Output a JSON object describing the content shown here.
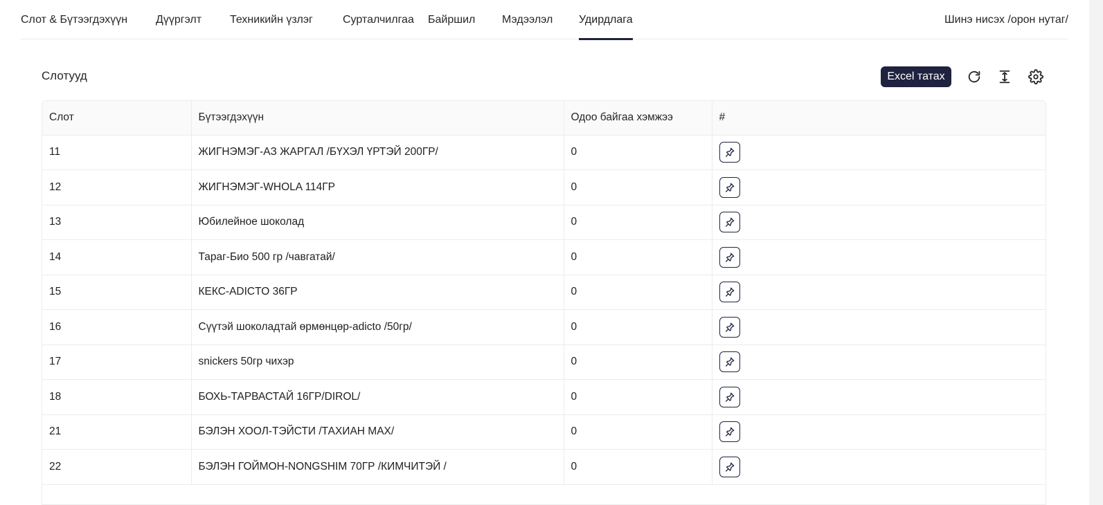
{
  "nav": {
    "tabs": [
      {
        "label": "Слот & Бүтээгдэхүүн"
      },
      {
        "label": "Дүүргэлт"
      },
      {
        "label": "Техникийн үзлэг"
      },
      {
        "label": "Сурталчилгаа"
      },
      {
        "label": "Байршил"
      },
      {
        "label": "Мэдээлэл"
      },
      {
        "label": "Удирдлага"
      }
    ],
    "active_tab": "Удирдлага",
    "right_label": "Шинэ нисэх /орон нутаг/"
  },
  "section": {
    "title": "Слотууд",
    "excel_button": "Excel татах",
    "icons": [
      "reload-icon",
      "column-height-icon",
      "settings-icon"
    ]
  },
  "table": {
    "columns": [
      "Слот",
      "Бүтээгдэхүүн",
      "Одоо байгаа хэмжээ",
      "#"
    ],
    "rows": [
      {
        "slot": "11",
        "product": "ЖИГНЭМЭГ-АЗ ЖАРГАЛ /БҮХЭЛ ҮРТЭЙ 200ГР/",
        "qty": "0"
      },
      {
        "slot": "12",
        "product": "ЖИГНЭМЭГ-WHOLA 114ГР",
        "qty": "0"
      },
      {
        "slot": "13",
        "product": "Юбилейное шоколад",
        "qty": "0"
      },
      {
        "slot": "14",
        "product": "Тараг-Био 500 гр /чавгатай/",
        "qty": "0"
      },
      {
        "slot": "15",
        "product": "КЕКС-ADICTO 36ГР",
        "qty": "0"
      },
      {
        "slot": "16",
        "product": "Сүүтэй шоколадтай өрмөнцөр-adicto /50гр/",
        "qty": "0"
      },
      {
        "slot": "17",
        "product": "snickers 50гр чихэр",
        "qty": "0"
      },
      {
        "slot": "18",
        "product": "БОХЬ-ТАРВАСТАЙ 16ГР/DIROL/",
        "qty": "0"
      },
      {
        "slot": "21",
        "product": "БЭЛЭН ХООЛ-ТЭЙСТИ /ТАХИАН МАХ/",
        "qty": "0"
      },
      {
        "slot": "22",
        "product": "БЭЛЭН ГОЙМОН-NONGSHIM 70ГР /КИМЧИТЭЙ /",
        "qty": "0"
      }
    ]
  },
  "colors": {
    "accent": "#1f2340",
    "border": "#ececec",
    "header_bg": "#fafafa"
  }
}
